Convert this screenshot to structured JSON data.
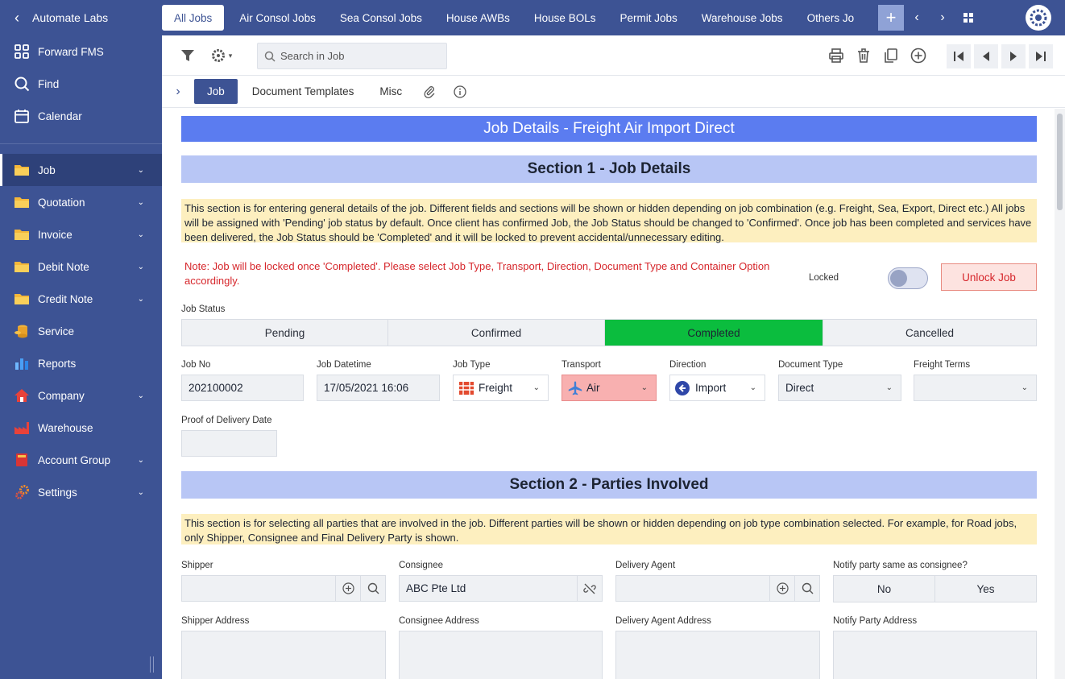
{
  "sidebar": {
    "org": "Automate Labs",
    "items": [
      {
        "label": "Forward FMS",
        "icon": "grid-icon"
      },
      {
        "label": "Find",
        "icon": "search-icon"
      },
      {
        "label": "Calendar",
        "icon": "calendar-icon"
      }
    ],
    "menu": [
      {
        "label": "Job",
        "icon": "folder-icon",
        "expandable": true,
        "active": true
      },
      {
        "label": "Quotation",
        "icon": "folder-icon",
        "expandable": true
      },
      {
        "label": "Invoice",
        "icon": "folder-icon",
        "expandable": true
      },
      {
        "label": "Debit Note",
        "icon": "folder-icon",
        "expandable": true
      },
      {
        "label": "Credit Note",
        "icon": "folder-icon",
        "expandable": true
      },
      {
        "label": "Service",
        "icon": "coins-icon",
        "expandable": false
      },
      {
        "label": "Reports",
        "icon": "bar-chart-icon",
        "expandable": false
      },
      {
        "label": "Company",
        "icon": "house-icon",
        "expandable": true
      },
      {
        "label": "Warehouse",
        "icon": "factory-icon",
        "expandable": false
      },
      {
        "label": "Account Group",
        "icon": "book-icon",
        "expandable": true
      },
      {
        "label": "Settings",
        "icon": "gears-icon",
        "expandable": true
      }
    ]
  },
  "tabs": [
    "All Jobs",
    "Air Consol Jobs",
    "Sea Consol Jobs",
    "House AWBs",
    "House BOLs",
    "Permit Jobs",
    "Warehouse Jobs",
    "Others Jo"
  ],
  "toolbar": {
    "search_placeholder": "Search in Job"
  },
  "subtabs": [
    "Job",
    "Document Templates",
    "Misc"
  ],
  "page": {
    "title": "Job Details - Freight Air Import Direct",
    "section1": {
      "title": "Section 1 - Job Details",
      "note": "This section is for entering general details of the job. Different fields and sections will be shown or hidden depending on job combination (e.g. Freight, Sea, Export, Direct etc.)  All jobs will be assigned with 'Pending' job status by default. Once client has confirmed Job, the Job Status should be changed to 'Confirmed'. Once job has been completed and services have been delivered, the Job Status should be 'Completed' and it will be locked to prevent accidental/unnecessary editing.",
      "warning": "Note: Job will be locked once 'Completed'. Please select Job Type, Transport, Direction, Document Type and Container Option accordingly.",
      "locked_label": "Locked",
      "unlock_button": "Unlock Job",
      "job_status_label": "Job Status",
      "statuses": [
        "Pending",
        "Confirmed",
        "Completed",
        "Cancelled"
      ],
      "active_status": "Completed",
      "fields": {
        "job_no": {
          "label": "Job No",
          "value": "202100002"
        },
        "job_datetime": {
          "label": "Job Datetime",
          "value": "17/05/2021 16:06"
        },
        "job_type": {
          "label": "Job Type",
          "value": "Freight"
        },
        "transport": {
          "label": "Transport",
          "value": "Air"
        },
        "direction": {
          "label": "Direction",
          "value": "Import"
        },
        "document_type": {
          "label": "Document Type",
          "value": "Direct"
        },
        "freight_terms": {
          "label": "Freight Terms",
          "value": ""
        },
        "pod_date": {
          "label": "Proof of Delivery Date",
          "value": ""
        }
      }
    },
    "section2": {
      "title": "Section 2 - Parties Involved",
      "note": "This section is for selecting all parties that are involved in the job. Different parties will be shown or hidden depending on job type combination selected. For example, for Road jobs, only Shipper, Consignee and Final Delivery Party is shown.",
      "shipper": {
        "label": "Shipper",
        "value": ""
      },
      "consignee": {
        "label": "Consignee",
        "value": "ABC Pte Ltd"
      },
      "delivery_agent": {
        "label": "Delivery Agent",
        "value": ""
      },
      "notify_same": {
        "label": "Notify party same as consignee?",
        "options": [
          "No",
          "Yes"
        ]
      },
      "shipper_address": "Shipper Address",
      "consignee_address": "Consignee Address",
      "delivery_agent_address": "Delivery Agent Address",
      "notify_party_address": "Notify Party Address"
    }
  },
  "colors": {
    "sidebar": "#3d5394",
    "title_bar": "#5b7cf0",
    "section_bar": "#b8c6f5",
    "note_bg": "#fdefbf",
    "completed": "#0bbd3e",
    "warning_text": "#d6262b"
  }
}
